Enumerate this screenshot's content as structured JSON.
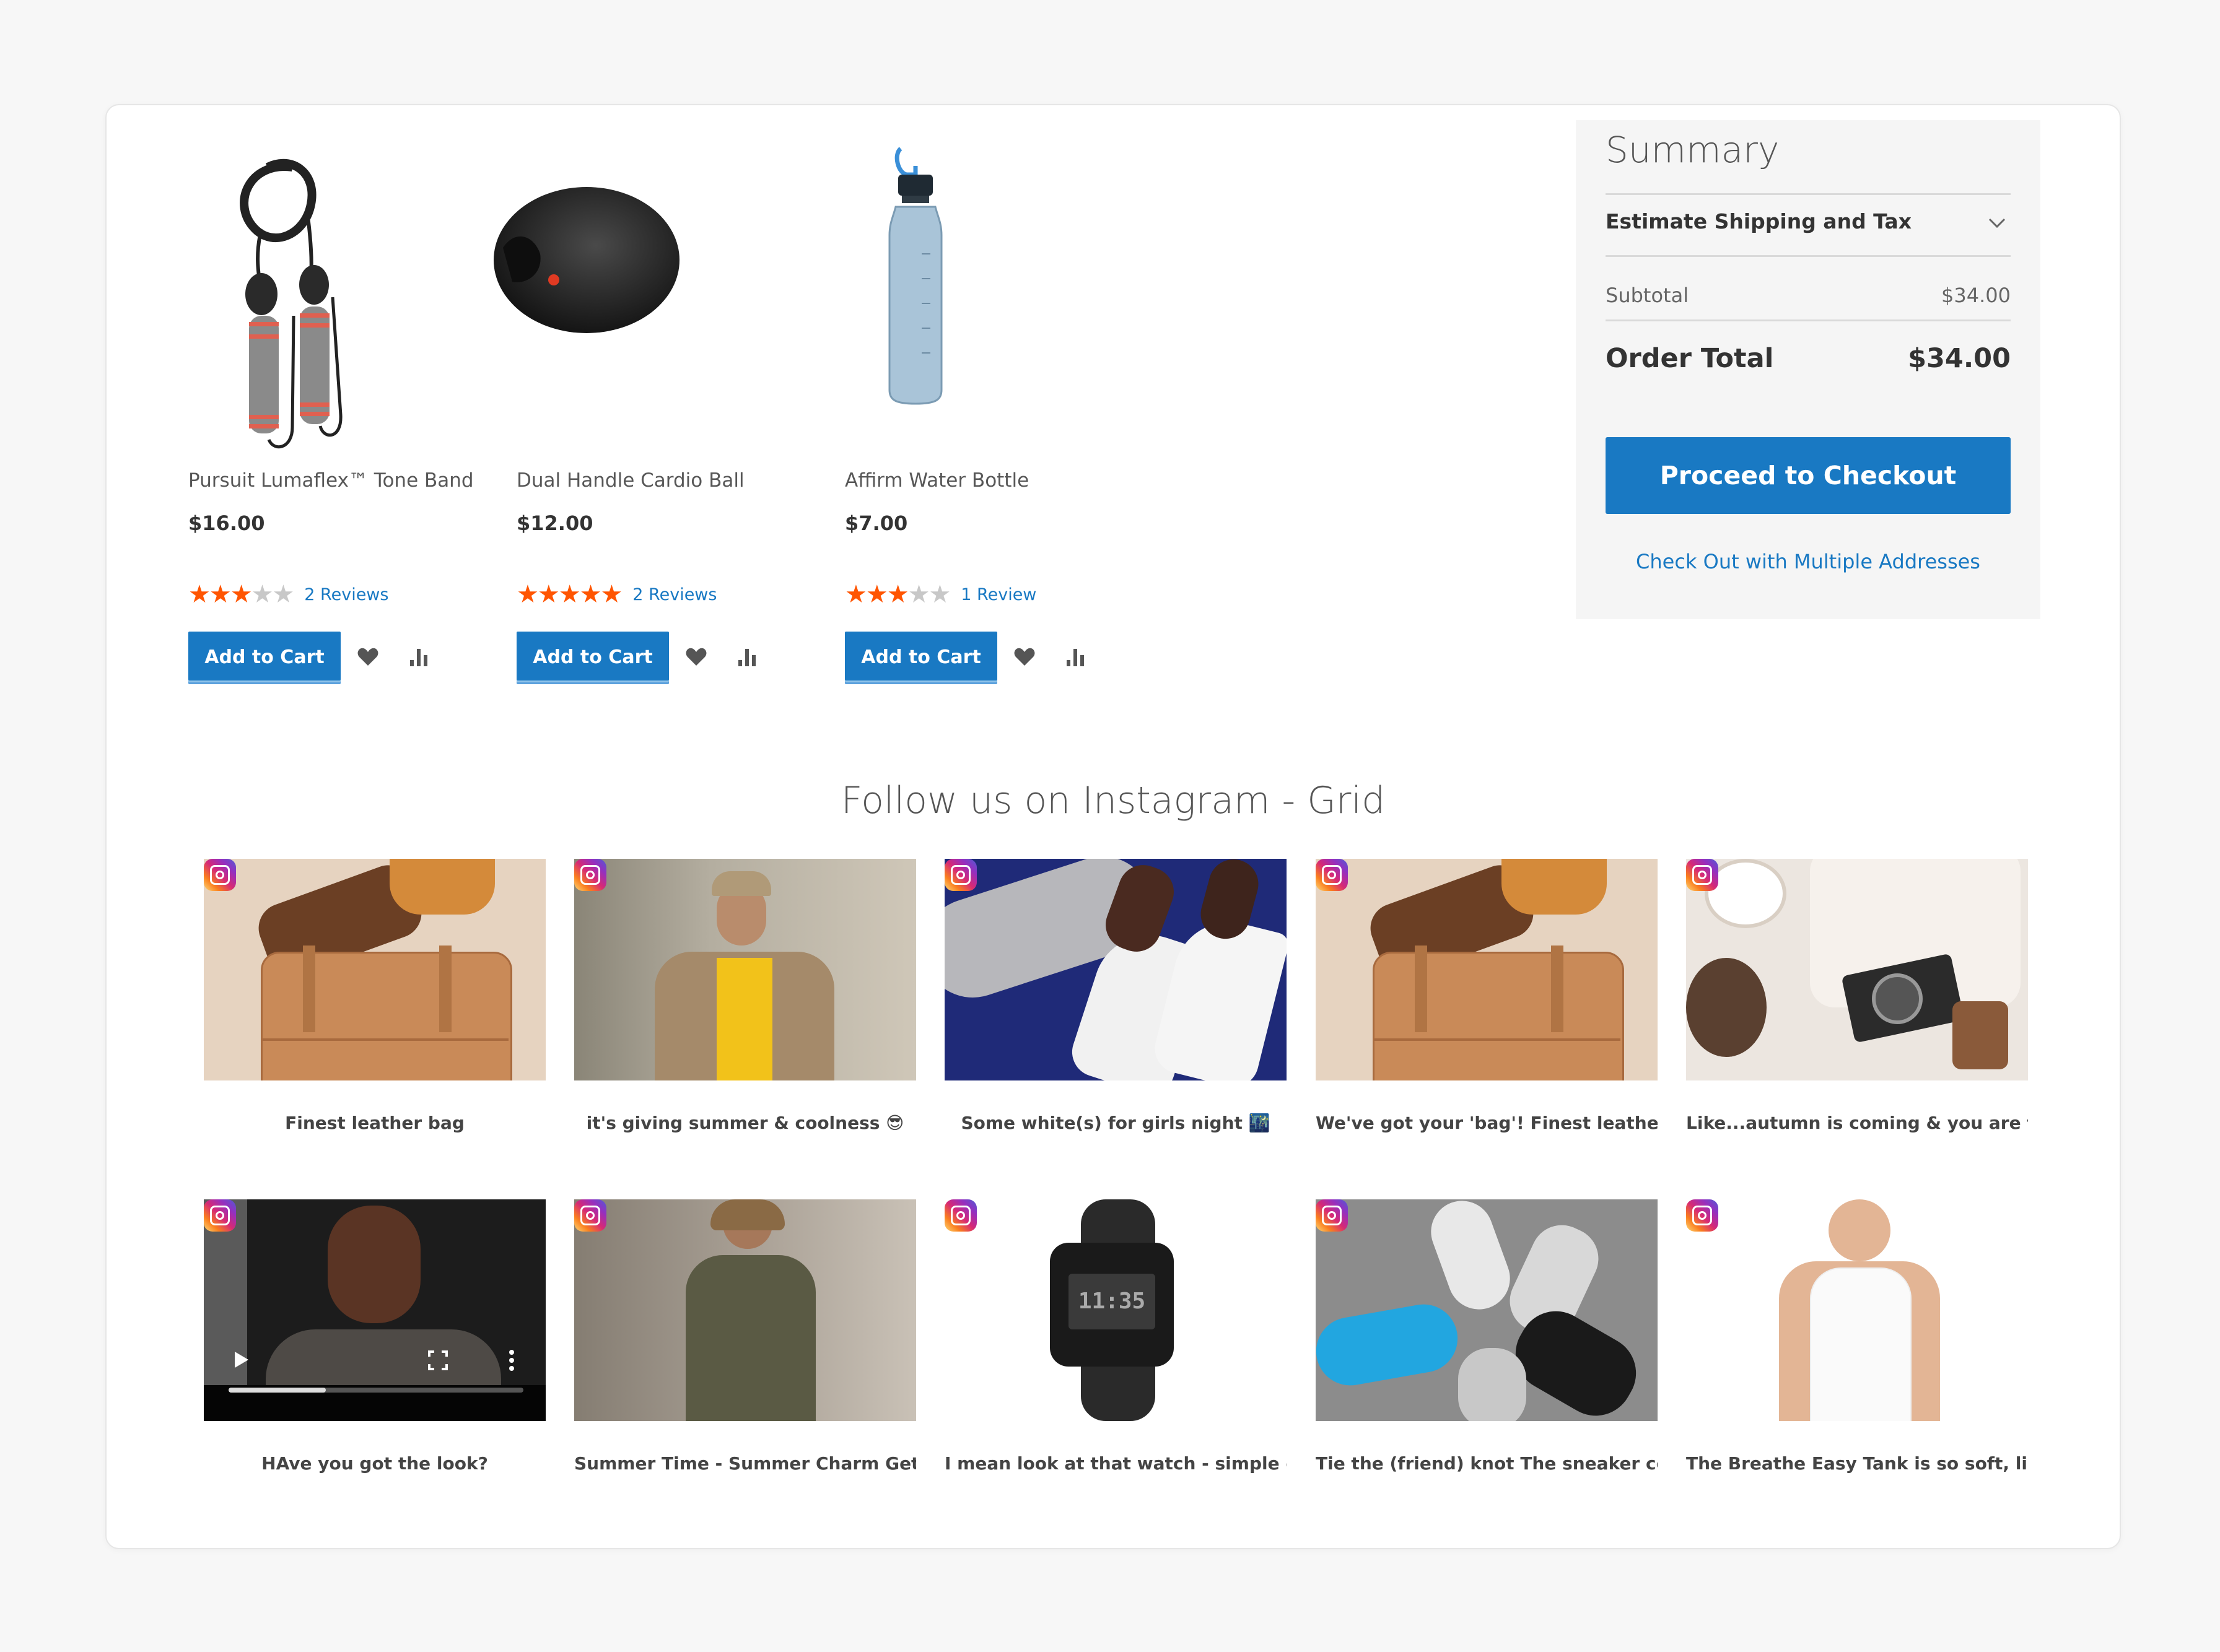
{
  "products": [
    {
      "name": "Pursuit Lumaflex™ Tone Band",
      "price": "$16.00",
      "rating_stars": 3,
      "max_stars": 5,
      "reviews_label": "2  Reviews",
      "add_to_cart": "Add to Cart",
      "image": "jump-rope-image"
    },
    {
      "name": "Dual Handle Cardio Ball",
      "price": "$12.00",
      "rating_stars": 5,
      "max_stars": 5,
      "reviews_label": "2  Reviews",
      "add_to_cart": "Add to Cart",
      "image": "cardio-ball-image"
    },
    {
      "name": "Affirm Water Bottle",
      "price": "$7.00",
      "rating_stars": 3,
      "max_stars": 5,
      "reviews_label": "1  Review",
      "add_to_cart": "Add to Cart",
      "image": "water-bottle-image"
    }
  ],
  "icons": {
    "wishlist": "heart-icon",
    "compare": "bar-chart-icon",
    "collapse": "chevron-down-icon",
    "instagram": "instagram-icon"
  },
  "summary": {
    "title": "Summary",
    "estimate_label": "Estimate Shipping and Tax",
    "subtotal_label": "Subtotal",
    "subtotal_value": "$34.00",
    "order_total_label": "Order Total",
    "order_total_value": "$34.00",
    "checkout_button": "Proceed to Checkout",
    "multi_address_link": "Check Out with Multiple Addresses"
  },
  "instagram": {
    "title": "Follow us on Instagram - Grid",
    "posts": [
      {
        "caption": "Finest leather bag",
        "image": "leather-bag-photo"
      },
      {
        "caption": "it's giving summer & coolness 😎",
        "image": "man-in-jacket-photo"
      },
      {
        "caption": "Some white(s) for girls night 🌃",
        "image": "white-heels-photo"
      },
      {
        "caption": "We've got your 'bag'! Finest leather ...",
        "image": "leather-bag-photo"
      },
      {
        "caption": "Like...autumn is coming & you are th...",
        "image": "sweater-camera-photo"
      },
      {
        "caption": "HAve you got the look?",
        "image": "woman-glasses-video",
        "video_progress": 0.33
      },
      {
        "caption": "Summer Time - Summer Charm Get t...",
        "image": "woman-olive-outfit-photo"
      },
      {
        "caption": "I mean look at that watch - simple el...",
        "image": "digital-watch-photo"
      },
      {
        "caption": "Tie the (friend) knot The sneaker coll...",
        "image": "sneakers-photo"
      },
      {
        "caption": "The Breathe Easy Tank is so soft, ligh...",
        "image": "white-tank-photo"
      }
    ]
  },
  "colors": {
    "accent": "#1979c3",
    "star": "#ff5501",
    "star_off": "#c8c8c8"
  }
}
